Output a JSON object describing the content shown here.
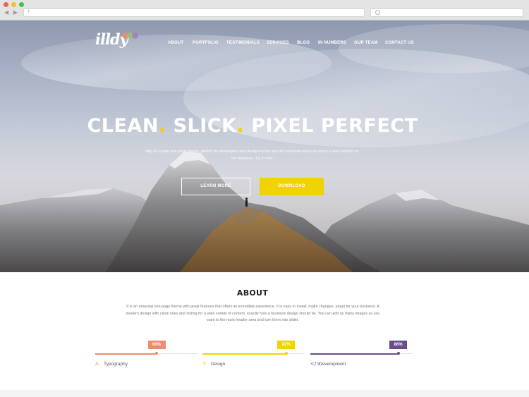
{
  "browser": {
    "nav_arrows": "◀ ▶",
    "url_plus": "+"
  },
  "brand": {
    "logo_text": "illdy",
    "logo_colors": [
      "#f18b6d",
      "#f1d204",
      "#6a4d8a"
    ]
  },
  "nav": {
    "items": [
      "ABOUT",
      "PORTFOLIO",
      "TESTIMONIALS",
      "SERVICES",
      "BLOG",
      "IN NUMBERS",
      "OUR TEAM",
      "CONTACT US"
    ]
  },
  "hero": {
    "headline_parts": [
      "CLEAN",
      ".",
      " SLICK",
      ".",
      " PIXEL PERFECT"
    ],
    "intro_text": "Illdy is a great one-page theme, perfect for developers and designers but also for someone who just wants a new website for his business. Try it now!",
    "learn_more_label": "LEARN MORE",
    "download_label": "DOWNLOAD",
    "accent_color": "#f1d204"
  },
  "about": {
    "title": "ABOUT",
    "text": "It is an amazing one-page theme with great features that offers an incredible experience. It is easy to install, make changes, adapt for your business. A modern design with clean lines and styling for a wide variety of content, exactly how a business design should be. You can add as many images as you want to the main header area and turn them into slider.",
    "skills": [
      {
        "name": "Typography",
        "percent_label": "60%",
        "percent": 60,
        "color": "#f18b6d",
        "icon": "A"
      },
      {
        "name": "Design",
        "percent_label": "82%",
        "percent": 82,
        "color": "#f1d204",
        "icon": "✎"
      },
      {
        "name": "Development",
        "percent_label": "86%",
        "percent": 86,
        "color": "#6a4d8a",
        "icon": "</>"
      }
    ]
  }
}
